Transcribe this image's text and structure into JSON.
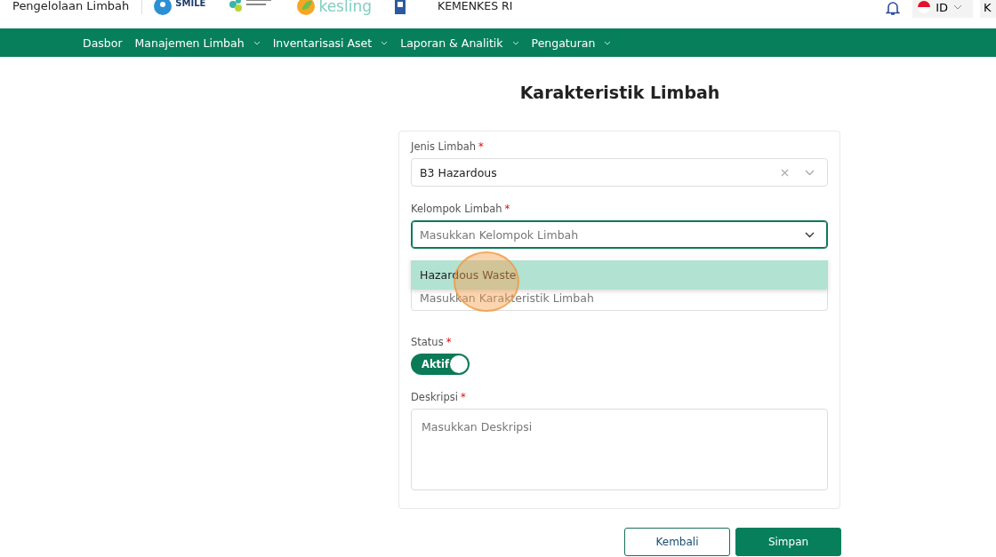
{
  "header": {
    "app_name": "Pengelolaan Limbah",
    "logos": [
      {
        "kind": "smile",
        "text": "SMILE"
      },
      {
        "kind": "emblem"
      },
      {
        "kind": "kesling",
        "text": "kesling"
      },
      {
        "kind": "flag"
      }
    ],
    "org": "KEMENKES RI",
    "language": "ID",
    "user_initial": "K"
  },
  "nav": [
    {
      "label": "Dasbor",
      "dropdown": false
    },
    {
      "label": "Manajemen Limbah",
      "dropdown": true
    },
    {
      "label": "Inventarisasi Aset",
      "dropdown": true
    },
    {
      "label": "Laporan & Analitik",
      "dropdown": true
    },
    {
      "label": "Pengaturan",
      "dropdown": true
    }
  ],
  "page_title": "Karakteristik Limbah",
  "form": {
    "fields": [
      {
        "kind": "select",
        "label": "Jenis Limbah",
        "mark": "*",
        "value": "B3 Hazardous",
        "focused": false,
        "clearable": true
      },
      {
        "kind": "select",
        "label": "Kelompok Limbah",
        "mark": "*",
        "placeholder": "Masukkan Kelompok Limbah",
        "focused": true,
        "clearable": false,
        "options": [
          {
            "label": "Hazardous Waste",
            "selected": true
          }
        ]
      },
      {
        "kind": "text",
        "placeholder": "Masukkan Karakteristik Limbah"
      },
      {
        "kind": "toggle",
        "label": "Status",
        "mark": "*",
        "on": true,
        "text": "Aktif"
      },
      {
        "kind": "textarea",
        "label": "Deskripsi",
        "mark": "*",
        "placeholder": "Masukkan Deskripsi"
      }
    ]
  },
  "buttons": [
    {
      "label": "Kembali",
      "kind": "secondary"
    },
    {
      "label": "Simpan",
      "kind": "primary"
    }
  ]
}
